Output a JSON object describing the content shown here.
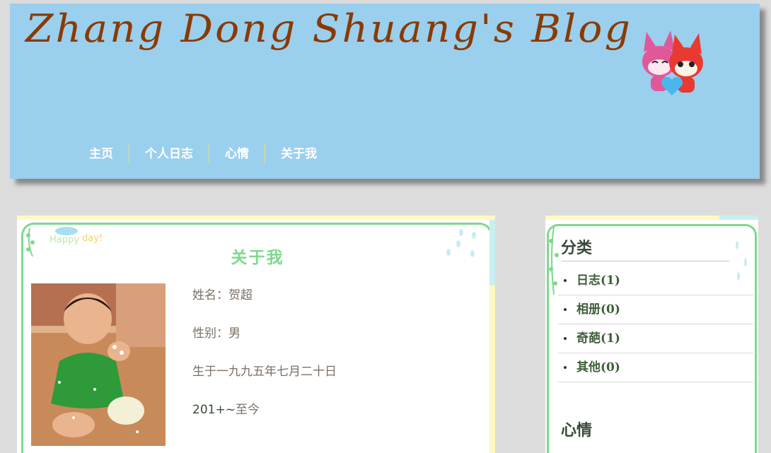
{
  "header": {
    "blog_title": "Zhang Dong Shuang's Blog",
    "background": "#9acfee",
    "title_color": "#8a3a00",
    "nav": [
      {
        "label": "主页"
      },
      {
        "label": "个人日志"
      },
      {
        "label": "心情"
      },
      {
        "label": "关于我"
      }
    ]
  },
  "main": {
    "title": "关于我",
    "info": {
      "name": "姓名：贺超",
      "gender": "性别：男",
      "birth": "生于一九九五年七月二十日",
      "period_prefix": "201+~",
      "period_suffix": "至今"
    }
  },
  "sidebar": {
    "categories_heading": "分类",
    "categories": [
      {
        "label": "日志(1)"
      },
      {
        "label": "相册(0)"
      },
      {
        "label": "奇葩(1)"
      },
      {
        "label": "其他(0)"
      }
    ],
    "mood_heading": "心情"
  },
  "colors": {
    "accent_green": "#7ed88f",
    "page_bg": "#dcdcdc"
  }
}
